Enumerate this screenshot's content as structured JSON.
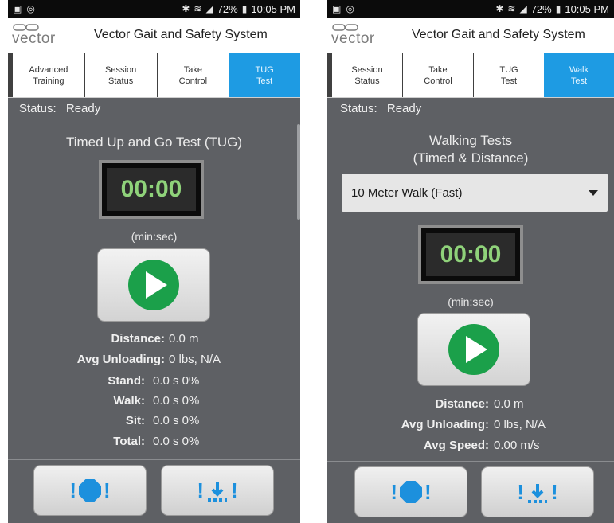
{
  "left": {
    "statusbar": {
      "battery": "72%",
      "time": "10:05 PM"
    },
    "app": {
      "logo": "vector",
      "title": "Vector Gait and Safety System"
    },
    "tabs": [
      {
        "line1": "Advanced",
        "line2": "Training"
      },
      {
        "line1": "Session",
        "line2": "Status"
      },
      {
        "line1": "Take",
        "line2": "Control"
      },
      {
        "line1": "TUG",
        "line2": "Test",
        "active": true
      }
    ],
    "status": {
      "label": "Status:",
      "value": "Ready"
    },
    "heading": "Timed Up and Go Test (TUG)",
    "timer": "00:00",
    "unit": "(min:sec)",
    "stats": [
      {
        "label": "Distance:",
        "value": "0.0 m"
      },
      {
        "label": "Avg Unloading:",
        "value": "0 lbs, N/A"
      },
      {
        "label": "Stand:",
        "value": "0.0 s  0%"
      },
      {
        "label": "Walk:",
        "value": "0.0 s  0%"
      },
      {
        "label": "Sit:",
        "value": "0.0 s  0%"
      },
      {
        "label": "Total:",
        "value": "0.0 s  0%"
      }
    ]
  },
  "right": {
    "statusbar": {
      "battery": "72%",
      "time": "10:05 PM"
    },
    "app": {
      "logo": "vector",
      "title": "Vector Gait and Safety System"
    },
    "tabs": [
      {
        "line1": "Session",
        "line2": "Status"
      },
      {
        "line1": "Take",
        "line2": "Control"
      },
      {
        "line1": "TUG",
        "line2": "Test"
      },
      {
        "line1": "Walk",
        "line2": "Test",
        "active": true
      }
    ],
    "status": {
      "label": "Status:",
      "value": "Ready"
    },
    "heading": {
      "line1": "Walking Tests",
      "line2": "(Timed & Distance)"
    },
    "dropdown": {
      "selected": "10 Meter Walk (Fast)"
    },
    "timer": "00:00",
    "unit": "(min:sec)",
    "stats": [
      {
        "label": "Distance:",
        "value": "0.0 m"
      },
      {
        "label": "Avg Unloading:",
        "value": "0 lbs, N/A"
      },
      {
        "label": "Avg Speed:",
        "value": "0.00 m/s"
      }
    ]
  },
  "icons": {
    "stop_button": "stop-octagon-icon",
    "download_button": "download-icon",
    "play_button": "play-icon"
  },
  "colors": {
    "accent": "#1e9be3",
    "timer_digits": "#8fd27a",
    "play": "#1ba04a",
    "background": "#5e6064"
  }
}
